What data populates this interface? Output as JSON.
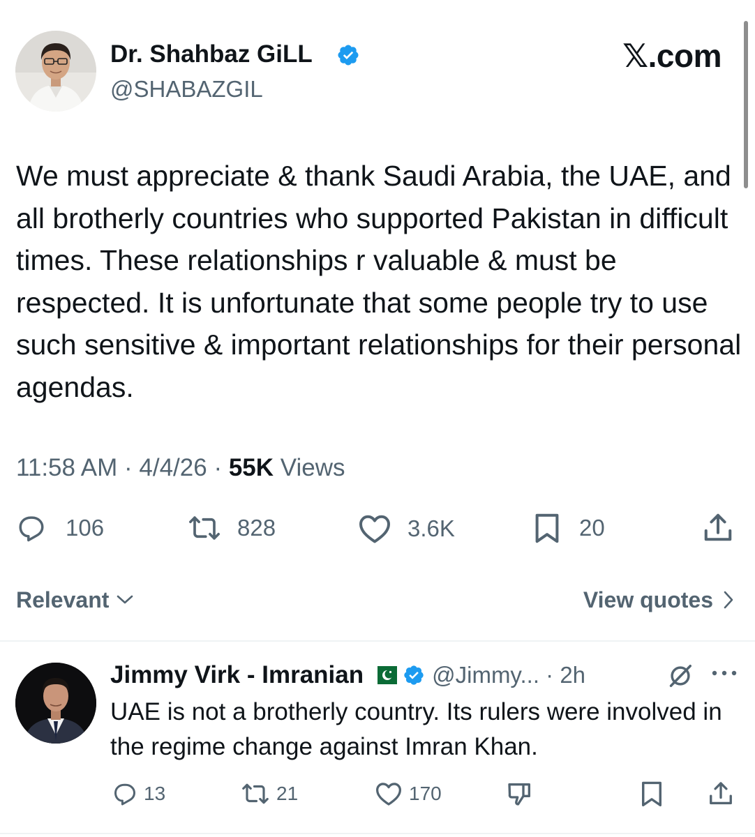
{
  "tweet": {
    "author_name": "Dr. Shahbaz GiLL",
    "author_handle": "@SHABAZGIL",
    "watermark": "𝕏.com",
    "text": "We must appreciate & thank Saudi Arabia, the UAE, and all brotherly countries who supported Pakistan in difficult times. These relationships r valuable & must be respected. It is unfortunate that some people try to use such sensitive & important relationships for their personal agendas.",
    "time": "11:58 AM",
    "date": "4/4/26",
    "separator": "·",
    "views_count": "55K",
    "views_label": "Views",
    "replies": "106",
    "reposts": "828",
    "likes": "3.6K",
    "bookmarks": "20"
  },
  "sort": {
    "label": "Relevant",
    "view_quotes": "View quotes"
  },
  "reply": {
    "author_name": "Jimmy Virk - Imranian",
    "handle_time": "@Jimmy... · 2h",
    "text": "UAE is not a brotherly country. Its rulers were involved in the regime change against Imran Khan.",
    "replies": "13",
    "reposts": "21",
    "likes": "170"
  },
  "icons": {
    "verified": "verified-badge-icon",
    "reply": "reply-bubble-icon",
    "repost": "repost-icon",
    "like": "heart-icon",
    "bookmark": "bookmark-icon",
    "share": "share-icon",
    "downvote": "thumbs-down-icon",
    "grok": "grok-icon",
    "more": "more-dots-icon",
    "flag": "pakistan-flag-icon"
  },
  "colors": {
    "text": "#0f1419",
    "secondary": "#536471",
    "verified": "#1d9bf0",
    "divider": "#eff3f4"
  }
}
